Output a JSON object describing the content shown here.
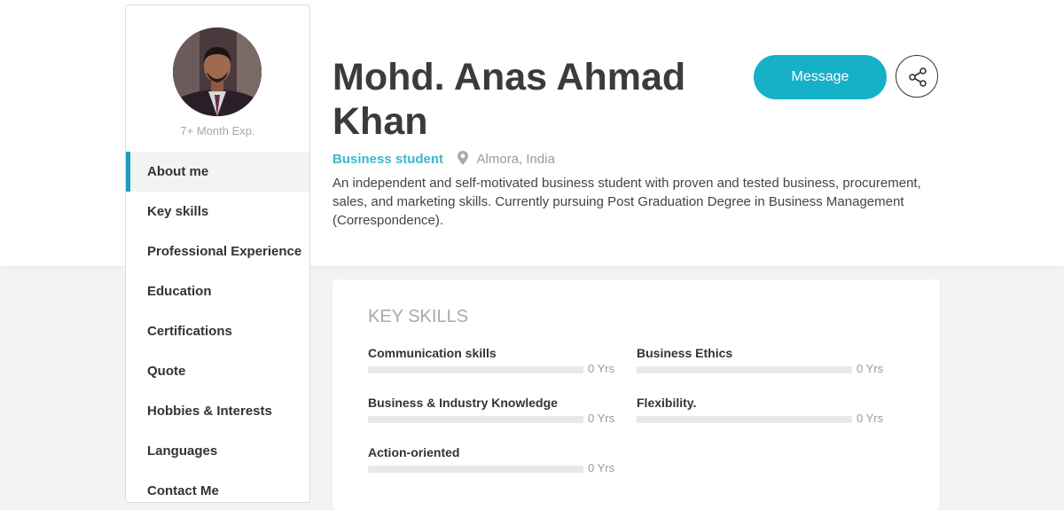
{
  "profile": {
    "name": "Mohd. Anas Ahmad Khan",
    "experience": "7+ Month Exp.",
    "role": "Business student",
    "location": "Almora, India",
    "bio": "An independent and self-motivated business student with proven and tested business, procurement, sales, and marketing skills. Currently pursuing Post Graduation Degree in Business Management (Correspondence)."
  },
  "actions": {
    "message_label": "Message",
    "share_icon": "share-icon"
  },
  "sidebar": {
    "items": [
      {
        "label": "About me",
        "active": true
      },
      {
        "label": "Key skills"
      },
      {
        "label": "Professional Experience"
      },
      {
        "label": "Education"
      },
      {
        "label": "Certifications"
      },
      {
        "label": "Quote"
      },
      {
        "label": "Hobbies & Interests"
      },
      {
        "label": "Languages"
      },
      {
        "label": "Contact Me"
      }
    ]
  },
  "key_skills": {
    "title": "KEY SKILLS",
    "skills": [
      {
        "name": "Communication skills",
        "years": "0 Yrs",
        "level": 0
      },
      {
        "name": "Business Ethics",
        "years": "0 Yrs",
        "level": 0
      },
      {
        "name": "Business & Industry Knowledge",
        "years": "0 Yrs",
        "level": 0
      },
      {
        "name": "Flexibility.",
        "years": "0 Yrs",
        "level": 0
      },
      {
        "name": "Action-oriented",
        "years": "0 Yrs",
        "level": 0
      }
    ]
  },
  "colors": {
    "accent": "#16b0c9",
    "role_text": "#3fb7c9",
    "active_indicator": "#1aa0b8"
  }
}
